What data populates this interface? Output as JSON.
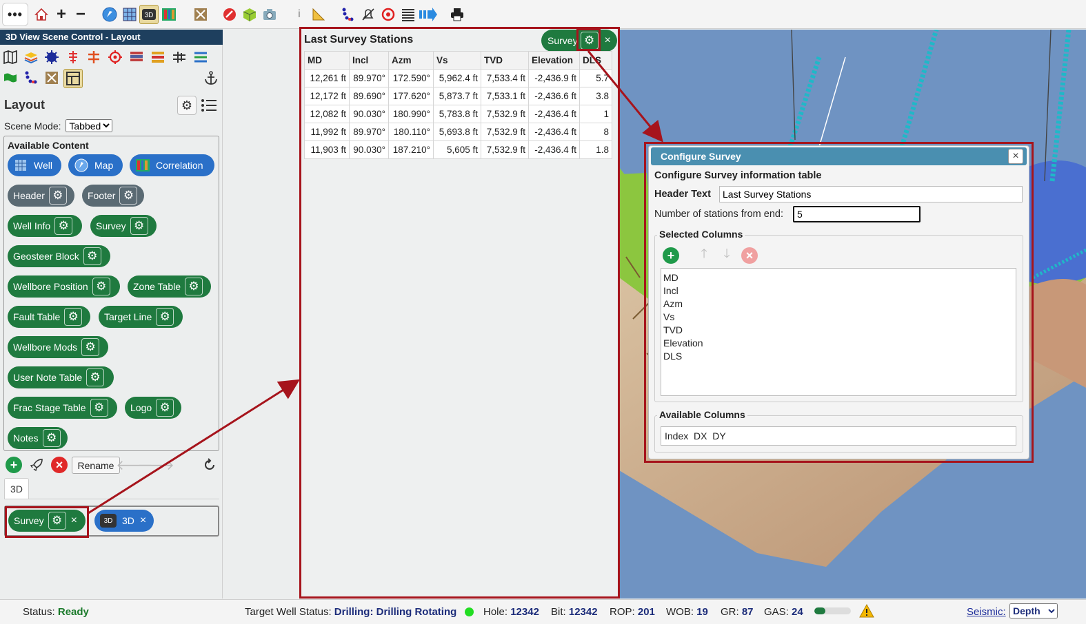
{
  "toolbar": {
    "menu_label": "•••",
    "icons": [
      "home-icon",
      "zoom-in-icon",
      "zoom-out-icon",
      "compass-icon",
      "grid-icon",
      "3d-view-icon",
      "correlation-icon",
      "gather-icon",
      "no-entry-icon",
      "cube-icon",
      "camera-icon",
      "info-icon",
      "ruler-icon",
      "survey-points-icon",
      "alarm-icon",
      "target-icon",
      "list-icon",
      "export-arrow-icon",
      "print-icon"
    ],
    "plus": "+",
    "minus": "−",
    "label_3d": "3D"
  },
  "left_panel": {
    "title": "3D View Scene Control - Layout",
    "layout_heading": "Layout",
    "scene_mode_label": "Scene Mode:",
    "scene_mode_value": "Tabbed",
    "available_content_title": "Available Content",
    "content_blue": [
      {
        "label": "Well"
      },
      {
        "label": "Map"
      },
      {
        "label": "Correlation"
      }
    ],
    "content_items": [
      {
        "label": "Header",
        "style": "gray"
      },
      {
        "label": "Footer",
        "style": "gray"
      },
      {
        "label": "Well Info",
        "style": "green"
      },
      {
        "label": "Survey",
        "style": "green"
      },
      {
        "label": "Geosteer Block",
        "style": "green"
      },
      {
        "label": "Wellbore Position",
        "style": "green"
      },
      {
        "label": "Zone Table",
        "style": "green"
      },
      {
        "label": "Fault Table",
        "style": "green"
      },
      {
        "label": "Target Line",
        "style": "green"
      },
      {
        "label": "Wellbore Mods",
        "style": "green"
      },
      {
        "label": "User Note Table",
        "style": "green"
      },
      {
        "label": "Frac Stage Table",
        "style": "green"
      },
      {
        "label": "Logo",
        "style": "green"
      },
      {
        "label": "Notes",
        "style": "green"
      }
    ],
    "rename_label": "Rename",
    "tab_label": "3D",
    "scene_items": [
      {
        "label": "Survey",
        "close": "×"
      },
      {
        "label": "3D",
        "close": "×"
      }
    ]
  },
  "survey_panel": {
    "title": "Last Survey Stations",
    "badge_label": "Survey",
    "badge_close": "×",
    "columns": [
      "MD",
      "Incl",
      "Azm",
      "Vs",
      "TVD",
      "Elevation",
      "DLS"
    ],
    "rows": [
      [
        "12,261 ft",
        "89.970°",
        "172.590°",
        "5,962.4 ft",
        "7,533.4 ft",
        "-2,436.9 ft",
        "5.7"
      ],
      [
        "12,172 ft",
        "89.690°",
        "177.620°",
        "5,873.7 ft",
        "7,533.1 ft",
        "-2,436.6 ft",
        "3.8"
      ],
      [
        "12,082 ft",
        "90.030°",
        "180.990°",
        "5,783.8 ft",
        "7,532.9 ft",
        "-2,436.4 ft",
        "1"
      ],
      [
        "11,992 ft",
        "89.970°",
        "180.110°",
        "5,693.8 ft",
        "7,532.9 ft",
        "-2,436.4 ft",
        "8"
      ],
      [
        "11,903 ft",
        "90.030°",
        "187.210°",
        "5,605 ft",
        "7,532.9 ft",
        "-2,436.4 ft",
        "1.8"
      ]
    ]
  },
  "dialog": {
    "title": "Configure Survey",
    "close": "×",
    "subtitle": "Configure Survey information table",
    "header_text_label": "Header Text",
    "header_text_value": "Last Survey Stations",
    "stations_label": "Number of stations from end:",
    "stations_value": "5",
    "selected_columns_title": "Selected Columns",
    "selected_columns": [
      "MD",
      "Incl",
      "Azm",
      "Vs",
      "TVD",
      "Elevation",
      "DLS"
    ],
    "available_columns_title": "Available Columns",
    "available_columns": "Index  DX  DY"
  },
  "status_bar": {
    "status_label": "Status:",
    "status_value": "Ready",
    "target_label": "Target Well Status:",
    "target_value": "Drilling: Drilling Rotating",
    "hole_label": "Hole:",
    "hole_value": "12342",
    "bit_label": "Bit:",
    "bit_value": "12342",
    "rop_label": "ROP:",
    "rop_value": "201",
    "wob_label": "WOB:",
    "wob_value": "19",
    "gr_label": "GR:",
    "gr_value": "87",
    "gas_label": "GAS:",
    "gas_value": "24",
    "gas_progress": 0.3,
    "seismic_label": "Seismic:",
    "seismic_value": "Depth"
  },
  "colors": {
    "green": "#1f7a3f",
    "blue": "#2a70c8",
    "gray": "#5a6a73",
    "highlight": "#a6141c",
    "title_bar": "#1e3f5e",
    "dialog_title": "#4a8fb0",
    "status_dot": "#22dd22"
  }
}
